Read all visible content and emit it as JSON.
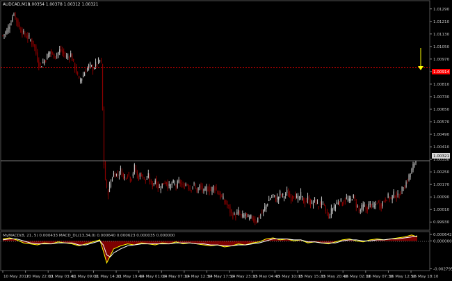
{
  "header": {
    "symbol": "AUDCAD,M10",
    "quote": "1.00354 1.00378 1.00312 1.00321"
  },
  "indicator": {
    "label": "MyMACD(8, 21, 5) 0.000433 MACD_DL(13,34,0) 0.000640 0.000623 0.000035 0.000000"
  },
  "colors": {
    "background": "#000000",
    "grid": "#3a3a3a",
    "bull_candle": "#c0c0c0",
    "bear_candle": "#8b0000",
    "resistance_line": "#ff0000",
    "current_price_line": "#8c8c8c",
    "arrow": "#ffff00",
    "macd_fill": "#8b0000",
    "macd_line": "#ffff00",
    "signal_line": "#ffffff"
  },
  "icons": {
    "arrow": "yellow-down-arrow-icon"
  },
  "chart_data": [
    {
      "type": "candlestick",
      "title": "AUDCAD,M10",
      "y_axis_ticks": [
        "1.01290",
        "1.01210",
        "1.01130",
        "1.01050",
        "1.00970",
        "1.00890",
        "1.00810",
        "1.00730",
        "1.00650",
        "1.00570",
        "1.00490",
        "1.00410",
        "1.00330",
        "1.00250",
        "1.00170",
        "1.00090",
        "1.00010",
        "0.99930"
      ],
      "ylim": [
        0.999,
        1.0132
      ],
      "x_axis_ticks": [
        "10 May 2012",
        "10 May 22:00",
        "11 May 03:40",
        "11 May 09:00",
        "11 May 14:20",
        "11 May 19:40",
        "14 May 01:00",
        "14 May 07:10",
        "14 May 12:30",
        "14 May 17:50",
        "14 May 23:10",
        "15 May 04:40",
        "15 May 10:00",
        "15 May 15:20",
        "15 May 20:40",
        "16 May 02:10",
        "16 May 07:30",
        "16 May 12:50",
        "16 May 18:10"
      ],
      "resistance_level": "1.00914",
      "current_price": "1.00321",
      "ohlc_summary": {
        "open": 1.00354,
        "high": 1.00378,
        "low": 1.00312,
        "close": 1.00321
      },
      "path": [
        [
          0,
          1.0112
        ],
        [
          6,
          1.0115
        ],
        [
          12,
          1.0121
        ],
        [
          16,
          1.0127
        ],
        [
          19,
          1.0122
        ],
        [
          24,
          1.0117
        ],
        [
          30,
          1.0113
        ],
        [
          38,
          1.011
        ],
        [
          45,
          1.0106
        ],
        [
          50,
          1.0097
        ],
        [
          53,
          1.0092
        ],
        [
          58,
          1.0095
        ],
        [
          63,
          1.0098
        ],
        [
          68,
          1.0102
        ],
        [
          73,
          1.0099
        ],
        [
          78,
          1.01
        ],
        [
          83,
          1.0103
        ],
        [
          88,
          1.01
        ],
        [
          93,
          1.0098
        ],
        [
          98,
          1.01
        ],
        [
          102,
          1.0094
        ],
        [
          106,
          1.0089
        ],
        [
          110,
          1.0083
        ],
        [
          115,
          1.0086
        ],
        [
          120,
          1.009
        ],
        [
          125,
          1.0093
        ],
        [
          130,
          1.0091
        ],
        [
          135,
          1.0094
        ],
        [
          140,
          1.0096
        ],
        [
          143,
          1.0093
        ],
        [
          145,
          1.0035
        ],
        [
          148,
          1.002
        ],
        [
          151,
          1.001
        ],
        [
          155,
          1.0018
        ],
        [
          160,
          1.0024
        ],
        [
          165,
          1.0023
        ],
        [
          170,
          1.0026
        ],
        [
          175,
          1.0021
        ],
        [
          180,
          1.0024
        ],
        [
          185,
          1.002
        ],
        [
          190,
          1.0028
        ],
        [
          195,
          1.0021
        ],
        [
          200,
          1.0024
        ],
        [
          205,
          1.0019
        ],
        [
          210,
          1.0022
        ],
        [
          215,
          1.0016
        ],
        [
          220,
          1.002
        ],
        [
          225,
          1.0014
        ],
        [
          230,
          1.0017
        ],
        [
          235,
          1.0019
        ],
        [
          240,
          1.0015
        ],
        [
          245,
          1.0018
        ],
        [
          250,
          1.0016
        ],
        [
          255,
          1.0019
        ],
        [
          260,
          1.0015
        ],
        [
          265,
          1.0018
        ],
        [
          270,
          1.0014
        ],
        [
          275,
          1.0017
        ],
        [
          280,
          1.0013
        ],
        [
          285,
          1.0016
        ],
        [
          290,
          1.0012
        ],
        [
          295,
          1.0015
        ],
        [
          300,
          1.0013
        ],
        [
          305,
          1.0016
        ],
        [
          310,
          1.0012
        ],
        [
          315,
          1.0009
        ],
        [
          320,
          1.0006
        ],
        [
          325,
          1.0003
        ],
        [
          330,
          0.9998
        ],
        [
          335,
          0.9997
        ],
        [
          340,
          0.9999
        ],
        [
          345,
          0.9996
        ],
        [
          350,
          0.9998
        ],
        [
          355,
          0.9995
        ],
        [
          360,
          0.9996
        ],
        [
          365,
          0.9993
        ],
        [
          370,
          0.9997
        ],
        [
          375,
          0.9999
        ],
        [
          380,
          1.0004
        ],
        [
          385,
          1.0008
        ],
        [
          390,
          1.001
        ],
        [
          395,
          1.0007
        ],
        [
          400,
          1.0011
        ],
        [
          405,
          1.0009
        ],
        [
          410,
          1.0012
        ],
        [
          415,
          1.0008
        ],
        [
          420,
          1.0011
        ],
        [
          425,
          1.0007
        ],
        [
          430,
          1.001
        ],
        [
          435,
          1.0005
        ],
        [
          440,
          1.0008
        ],
        [
          445,
          1.0004
        ],
        [
          450,
          1.0007
        ],
        [
          455,
          1.0003
        ],
        [
          460,
          1.0006
        ],
        [
          465,
          1.0001
        ],
        [
          470,
          0.9996
        ],
        [
          475,
          1.0001
        ],
        [
          480,
          1.0004
        ],
        [
          485,
          1.0007
        ],
        [
          490,
          1.0005
        ],
        [
          495,
          1.0008
        ],
        [
          500,
          1.0006
        ],
        [
          505,
          1.001
        ],
        [
          510,
          1.0004
        ],
        [
          515,
          1.0
        ],
        [
          520,
          1.0003
        ],
        [
          525,
          1.0001
        ],
        [
          530,
          1.0005
        ],
        [
          535,
          1.0002
        ],
        [
          540,
          1.0006
        ],
        [
          545,
          1.0003
        ],
        [
          550,
          1.0007
        ],
        [
          555,
          1.0009
        ],
        [
          560,
          1.0008
        ],
        [
          565,
          1.0011
        ],
        [
          570,
          1.0009
        ],
        [
          575,
          1.0013
        ],
        [
          580,
          1.0016
        ],
        [
          585,
          1.0021
        ],
        [
          590,
          1.0026
        ],
        [
          595,
          1.0032
        ],
        [
          598,
          1.0032
        ]
      ]
    },
    {
      "type": "area",
      "title": "MyMACD(8, 21, 5)",
      "y_axis_ticks": [
        "0.000642",
        "0.000000",
        "-0.002795"
      ],
      "ylim": [
        -0.0029,
        0.00072
      ],
      "macd": [
        [
          0,
          0.0002
        ],
        [
          10,
          0.0003
        ],
        [
          20,
          0.0001
        ],
        [
          30,
          -0.0002
        ],
        [
          40,
          -0.0003
        ],
        [
          50,
          -0.0004
        ],
        [
          60,
          -0.0002
        ],
        [
          70,
          -0.0003
        ],
        [
          80,
          -0.0001
        ],
        [
          90,
          -0.0002
        ],
        [
          100,
          -0.0003
        ],
        [
          110,
          -0.0005
        ],
        [
          120,
          -0.0003
        ],
        [
          130,
          -0.0001
        ],
        [
          140,
          0.0001
        ],
        [
          145,
          -0.001
        ],
        [
          150,
          -0.0022
        ],
        [
          155,
          -0.0015
        ],
        [
          160,
          -0.0008
        ],
        [
          170,
          -0.0005
        ],
        [
          180,
          -0.0003
        ],
        [
          190,
          -0.0004
        ],
        [
          200,
          -0.0002
        ],
        [
          210,
          -0.0003
        ],
        [
          220,
          -0.0004
        ],
        [
          230,
          -0.0002
        ],
        [
          240,
          -0.0003
        ],
        [
          250,
          -0.0001
        ],
        [
          260,
          -0.0003
        ],
        [
          270,
          -0.0002
        ],
        [
          280,
          -0.0003
        ],
        [
          290,
          -0.0004
        ],
        [
          300,
          -0.0005
        ],
        [
          310,
          -0.0004
        ],
        [
          320,
          -0.0006
        ],
        [
          330,
          -0.0005
        ],
        [
          340,
          -0.0003
        ],
        [
          350,
          -0.0004
        ],
        [
          360,
          -0.0002
        ],
        [
          370,
          -0.0001
        ],
        [
          380,
          0.0002
        ],
        [
          390,
          0.0003
        ],
        [
          400,
          0.0001
        ],
        [
          410,
          0.0002
        ],
        [
          420,
          0.0
        ],
        [
          430,
          0.0001
        ],
        [
          440,
          -0.0002
        ],
        [
          450,
          -0.0001
        ],
        [
          460,
          -0.0002
        ],
        [
          470,
          -0.0003
        ],
        [
          480,
          -0.0001
        ],
        [
          490,
          0.0001
        ],
        [
          500,
          0.0002
        ],
        [
          510,
          0.0
        ],
        [
          520,
          -0.0001
        ],
        [
          530,
          0.0001
        ],
        [
          540,
          0.0002
        ],
        [
          550,
          0.0001
        ],
        [
          560,
          0.0002
        ],
        [
          570,
          0.0003
        ],
        [
          580,
          0.0004
        ],
        [
          590,
          0.0006
        ],
        [
          598,
          0.0004
        ]
      ],
      "signal": [
        [
          0,
          0.0001
        ],
        [
          10,
          0.0002
        ],
        [
          20,
          0.0002
        ],
        [
          30,
          0.0
        ],
        [
          40,
          -0.0002
        ],
        [
          50,
          -0.0003
        ],
        [
          60,
          -0.0003
        ],
        [
          70,
          -0.0003
        ],
        [
          80,
          -0.0002
        ],
        [
          90,
          -0.0002
        ],
        [
          100,
          -0.0002
        ],
        [
          110,
          -0.0004
        ],
        [
          120,
          -0.0004
        ],
        [
          130,
          -0.0002
        ],
        [
          140,
          0.0
        ],
        [
          145,
          -0.0004
        ],
        [
          150,
          -0.0014
        ],
        [
          155,
          -0.0016
        ],
        [
          160,
          -0.0012
        ],
        [
          170,
          -0.0008
        ],
        [
          180,
          -0.0005
        ],
        [
          190,
          -0.0004
        ],
        [
          200,
          -0.0003
        ],
        [
          210,
          -0.0003
        ],
        [
          220,
          -0.0003
        ],
        [
          230,
          -0.0003
        ],
        [
          240,
          -0.0003
        ],
        [
          250,
          -0.0002
        ],
        [
          260,
          -0.0002
        ],
        [
          270,
          -0.0002
        ],
        [
          280,
          -0.0003
        ],
        [
          290,
          -0.0003
        ],
        [
          300,
          -0.0004
        ],
        [
          310,
          -0.0004
        ],
        [
          320,
          -0.0005
        ],
        [
          330,
          -0.0005
        ],
        [
          340,
          -0.0004
        ],
        [
          350,
          -0.0004
        ],
        [
          360,
          -0.0003
        ],
        [
          370,
          -0.0002
        ],
        [
          380,
          0.0
        ],
        [
          390,
          0.0002
        ],
        [
          400,
          0.0002
        ],
        [
          410,
          0.0002
        ],
        [
          420,
          0.0001
        ],
        [
          430,
          0.0001
        ],
        [
          440,
          -0.0001
        ],
        [
          450,
          -0.0001
        ],
        [
          460,
          -0.0002
        ],
        [
          470,
          -0.0002
        ],
        [
          480,
          -0.0002
        ],
        [
          490,
          0.0
        ],
        [
          500,
          0.0001
        ],
        [
          510,
          0.0001
        ],
        [
          520,
          0.0
        ],
        [
          530,
          0.0
        ],
        [
          540,
          0.0001
        ],
        [
          550,
          0.0001
        ],
        [
          560,
          0.0002
        ],
        [
          570,
          0.0002
        ],
        [
          580,
          0.0003
        ],
        [
          590,
          0.0004
        ],
        [
          598,
          0.0005
        ]
      ]
    }
  ]
}
